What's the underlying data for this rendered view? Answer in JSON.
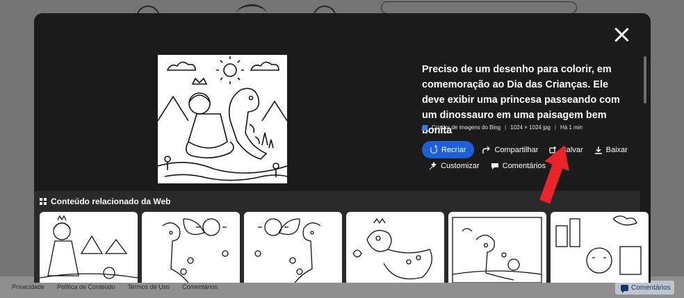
{
  "modal": {
    "prompt": "Preciso de um desenho para colorir, em comemoração ao Dia das Crianças. Ele deve exibir uma princesa passeando com um dinossauro em uma paisagem bem bonita",
    "meta": {
      "source": "Criador de imagens do Bing",
      "size": "1024 × 1024 jpg",
      "time": "Há 1 min",
      "separator": "|"
    },
    "actions": {
      "recreate": "Recriar",
      "share": "Compartilhar",
      "save": "Salvar",
      "download": "Baixar",
      "customize": "Customizar",
      "comments": "Comentários"
    },
    "related_title": "Conteúdo relacionado da Web",
    "icons": {
      "close": "close-icon",
      "bing": "bing-icon",
      "recreate": "refresh-icon",
      "share": "share-icon",
      "save": "save-icon",
      "download": "download-icon",
      "customize": "customize-icon",
      "comments": "comment-icon",
      "related": "grid-icon"
    }
  },
  "footer": {
    "links": [
      "Privacidade",
      "Política de Conteúdo",
      "Termos de Uso",
      "Comentários"
    ],
    "comments_button": "Comentários"
  },
  "colors": {
    "modal_bg": "#1b1b1b",
    "primary_button": "#1f5fd6",
    "annotation_arrow": "#e8242b",
    "related_bg": "#2a2a2a"
  }
}
